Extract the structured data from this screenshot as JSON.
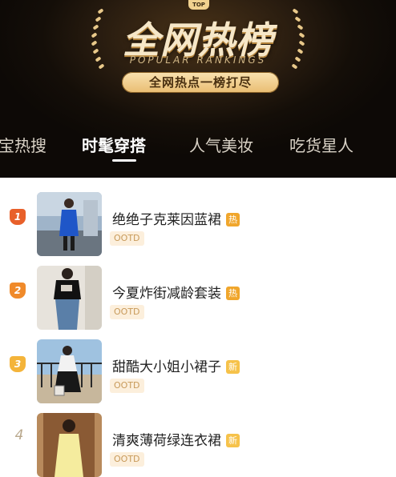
{
  "header": {
    "crown_text": "TOP",
    "title": "全网热榜",
    "subtitle": "POPULAR RANKINGS",
    "slogan": "全网热点一榜打尽"
  },
  "tabs": [
    {
      "label": "宝热搜",
      "active": false
    },
    {
      "label": "时髦穿搭",
      "active": true
    },
    {
      "label": "人气美妆",
      "active": false
    },
    {
      "label": "吃货星人",
      "active": false
    }
  ],
  "items": [
    {
      "rank": "1",
      "title": "绝绝子克莱因蓝裙",
      "flag": "热",
      "tag": "OOTD"
    },
    {
      "rank": "2",
      "title": "今夏炸街减龄套装",
      "flag": "热",
      "tag": "OOTD"
    },
    {
      "rank": "3",
      "title": "甜酷大小姐小裙子",
      "flag": "新",
      "tag": "OOTD"
    },
    {
      "rank": "4",
      "title": "清爽薄荷绿连衣裙",
      "flag": "新",
      "tag": "OOTD"
    }
  ],
  "colors": {
    "rank1": "#e8602a",
    "rank2": "#f08a2a",
    "rank3": "#f4b43a",
    "hot_flag": "#f0a62c",
    "new_flag": "#f6c24a",
    "accent_gold": "#e9bd72"
  }
}
